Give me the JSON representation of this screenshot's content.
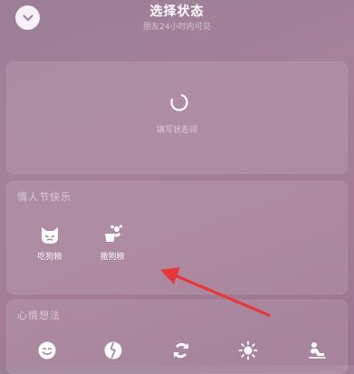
{
  "header": {
    "title": "选择状态",
    "subtitle": "朋友24小时内可见",
    "back_icon": "chevron-down-icon"
  },
  "status_input": {
    "placeholder": "填写状态词",
    "icon": "refresh-icon"
  },
  "valentine_section": {
    "title": "情人节快乐",
    "items": [
      {
        "label": "吃狗粮",
        "icon": "cat-face-icon"
      },
      {
        "label": "撒狗粮",
        "icon": "toss-dogfood-icon"
      }
    ]
  },
  "mood_section": {
    "title": "心情想法",
    "icons": [
      "smiley-icon",
      "anxious-icon",
      "swirl-icon",
      "sun-icon",
      "relaxing-icon"
    ]
  },
  "annotation": {
    "arrow_color": "#e8373a"
  }
}
